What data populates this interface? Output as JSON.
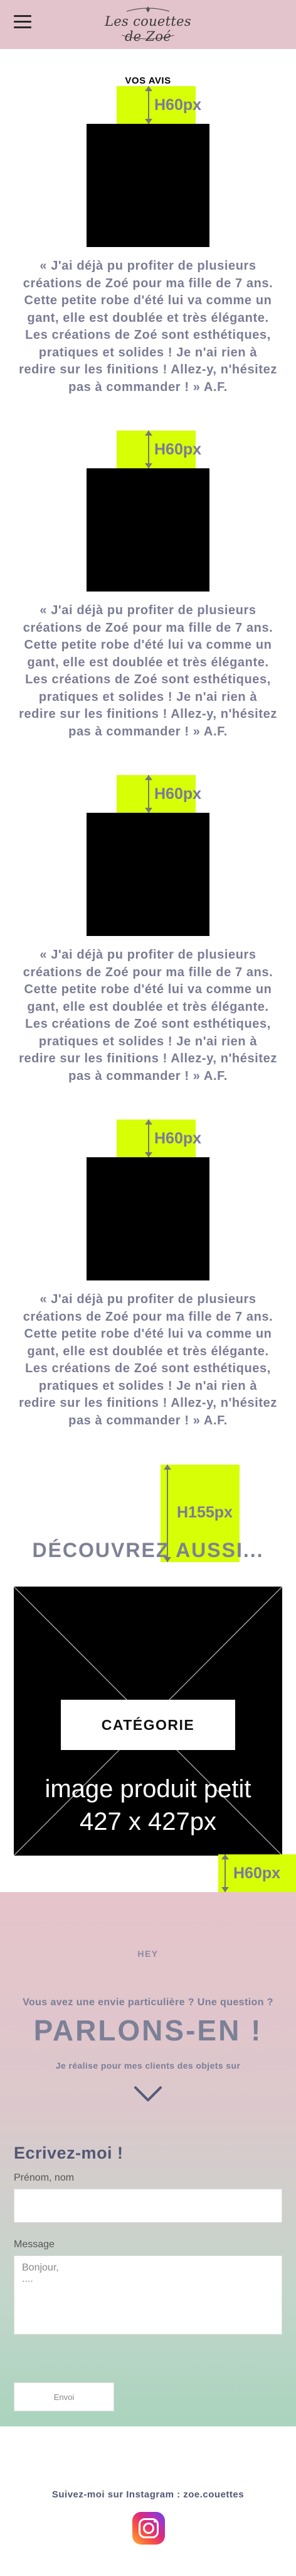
{
  "header": {
    "logo_text": "Les couettes de Zoé",
    "brand_color": "#e4c4cc"
  },
  "reviews": {
    "title": "VOS AVIS",
    "spacer_label": "H60px",
    "items": [
      {
        "text": "« J'ai déjà pu profiter de plusieurs créations de Zoé pour ma fille de 7 ans. Cette petite robe d'été lui va comme un gant, elle est doublée et très élégante. Les créations de Zoé sont esthétiques, pratiques et solides ! Je n'ai rien à redire sur les finitions ! Allez-y, n'hésitez pas à commander ! » A.F."
      },
      {
        "text": "« J'ai déjà pu profiter de plusieurs créations de Zoé pour ma fille de 7 ans. Cette petite robe d'été lui va comme un gant, elle est doublée et très élégante. Les créations de Zoé sont esthétiques, pratiques et solides ! Je n'ai rien à redire sur les finitions ! Allez-y, n'hésitez pas à commander ! » A.F."
      },
      {
        "text": "« J'ai déjà pu profiter de plusieurs créations de Zoé pour ma fille de 7 ans. Cette petite robe d'été lui va comme un gant, elle est doublée et très élégante. Les créations de Zoé sont esthétiques, pratiques et solides ! Je n'ai rien à redire sur les finitions ! Allez-y, n'hésitez pas à commander ! » A.F."
      },
      {
        "text": "« J'ai déjà pu profiter de plusieurs créations de Zoé pour ma fille de 7 ans. Cette petite robe d'été lui va comme un gant, elle est doublée et très élégante. Les créations de Zoé sont esthétiques, pratiques et solides ! Je n'ai rien à redire sur les finitions ! Allez-y, n'hésitez pas à commander ! » A.F."
      }
    ]
  },
  "discover": {
    "spacer_label": "H155px",
    "title": "DÉCOUVREZ AUSSI...",
    "category_button": "CATÉGORIE",
    "placeholder_line1": "image produit petit",
    "placeholder_line2": "427 x 427px",
    "spacer_label_bottom": "H60px"
  },
  "contact": {
    "hey": "HEY",
    "question": "Vous avez une envie particulière ? Une question ?",
    "headline": "PARLONS-EN !",
    "subline": "Je réalise pour mes clients des objets sur",
    "form_title": "Ecrivez-moi !",
    "name_label": "Prénom, nom",
    "message_label": "Message",
    "message_value": "Bonjour,\n....",
    "send_label": "Envoi"
  },
  "footer": {
    "follow_text": "Suivez-moi sur Instagram : zoe.couettes",
    "instagram_icon": "instagram-icon"
  },
  "colors": {
    "spacer": "#d7ff06",
    "text_muted": "#7a7c95",
    "form_title": "#525774"
  }
}
